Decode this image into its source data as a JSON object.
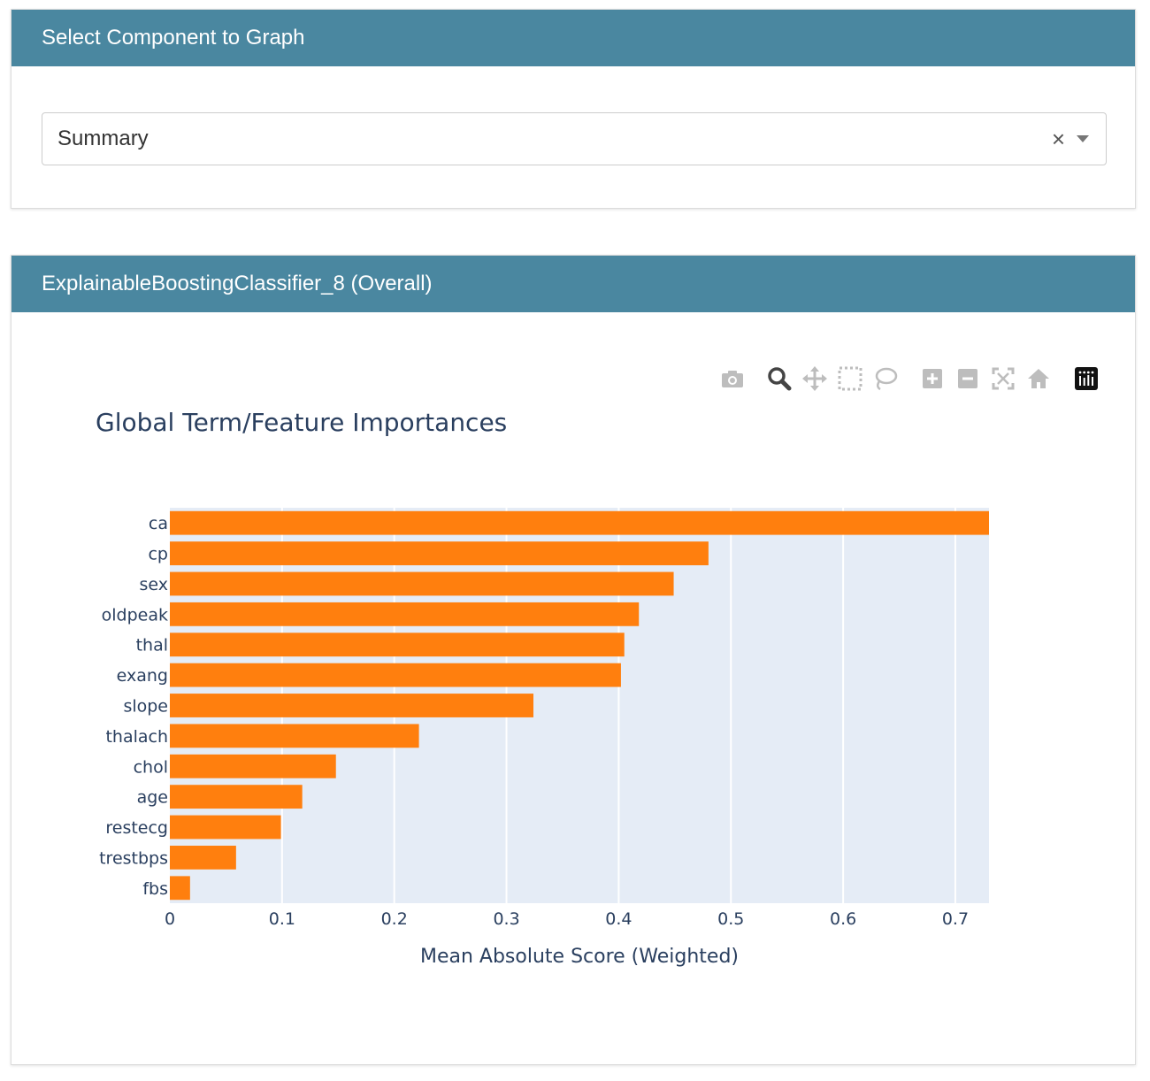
{
  "selector": {
    "header": "Select Component to Graph",
    "selected_value": "Summary",
    "clear_glyph": "×"
  },
  "panel": {
    "header": "ExplainableBoostingClassifier_8 (Overall)"
  },
  "modebar": {
    "icons": [
      "camera-icon",
      "zoom-icon",
      "pan-icon",
      "box-select-icon",
      "lasso-icon",
      "zoom-in-icon",
      "zoom-out-icon",
      "autoscale-icon",
      "reset-axes-icon",
      "plotly-logo-icon"
    ],
    "active_icon": "zoom-icon"
  },
  "colors": {
    "header_bg": "#4a87a0",
    "bar": "#ff7f0e",
    "plot_bg": "#e5ecf6",
    "text": "#2a3f5f"
  },
  "chart_data": {
    "type": "bar",
    "orientation": "horizontal",
    "title": "Global Term/Feature Importances",
    "xlabel": "Mean Absolute Score (Weighted)",
    "ylabel": "",
    "categories": [
      "ca",
      "cp",
      "sex",
      "oldpeak",
      "thal",
      "exang",
      "slope",
      "thalach",
      "chol",
      "age",
      "restecg",
      "trestbps",
      "fbs"
    ],
    "values": [
      0.73,
      0.48,
      0.449,
      0.418,
      0.405,
      0.402,
      0.324,
      0.222,
      0.148,
      0.118,
      0.099,
      0.059,
      0.018
    ],
    "xlim": [
      0,
      0.73
    ],
    "xticks": [
      0,
      0.1,
      0.2,
      0.3,
      0.4,
      0.5,
      0.6,
      0.7
    ],
    "xtick_labels": [
      "0",
      "0.1",
      "0.2",
      "0.3",
      "0.4",
      "0.5",
      "0.6",
      "0.7"
    ],
    "grid": true,
    "legend": false
  }
}
